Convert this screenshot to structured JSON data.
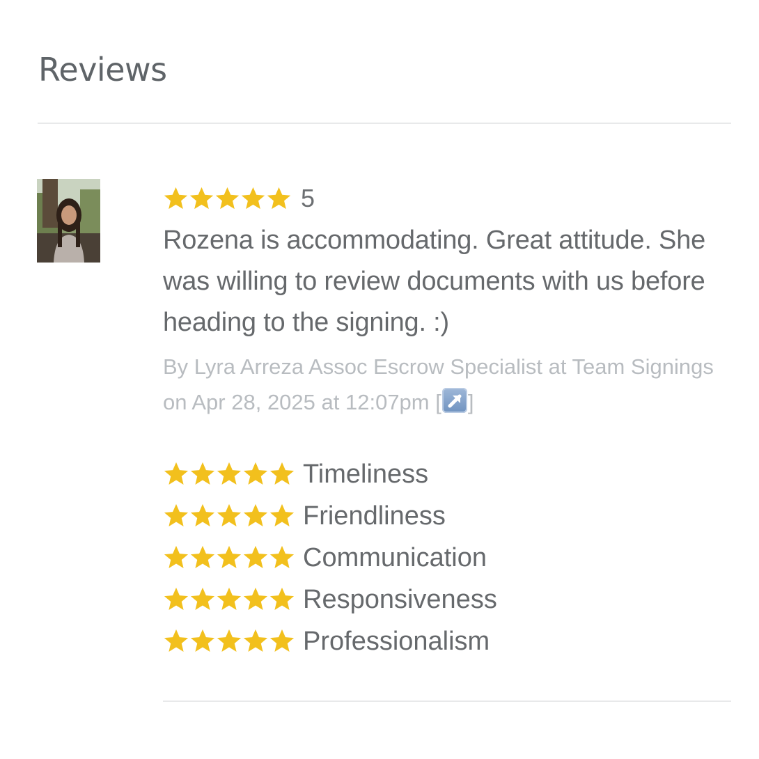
{
  "section": {
    "title": "Reviews"
  },
  "review": {
    "rating": 5,
    "rating_label": "5",
    "star_color": "#f2c01d",
    "text": "Rozena is accommodating. Great attitude. She was willing to review documents with us before heading to the signing. :)",
    "byline_text": "By Lyra Arreza Assoc Escrow Specialist at Team Signings on Apr 28, 2025 at 12:07pm",
    "link_open": "[",
    "link_close": "]",
    "link_icon": "external-link-arrow-icon",
    "criteria": [
      {
        "label": "Timeliness",
        "rating": 5
      },
      {
        "label": "Friendliness",
        "rating": 5
      },
      {
        "label": "Communication",
        "rating": 5
      },
      {
        "label": "Responsiveness",
        "rating": 5
      },
      {
        "label": "Professionalism",
        "rating": 5
      }
    ]
  }
}
